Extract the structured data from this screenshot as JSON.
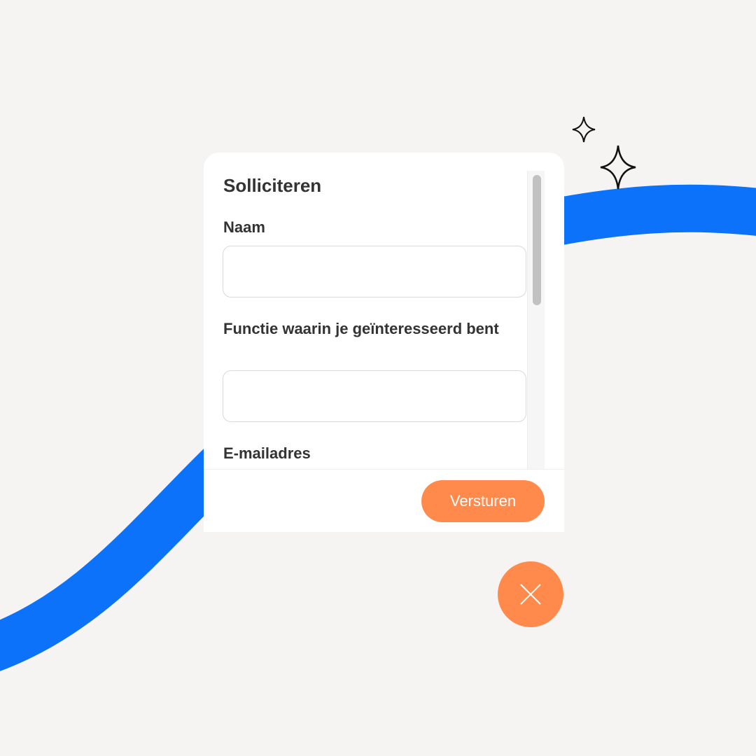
{
  "form": {
    "title": "Solliciteren",
    "fields": [
      {
        "label": "Naam",
        "value": "",
        "placeholder": ""
      },
      {
        "label": "Functie waarin je geïnteresseerd bent",
        "value": "",
        "placeholder": ""
      },
      {
        "label": "E-mailadres",
        "value": "",
        "placeholder": ""
      }
    ],
    "submit_label": "Versturen"
  },
  "close_button": {
    "icon": "close-icon",
    "label": "Sluiten"
  },
  "colors": {
    "accent": "#ff8a4c",
    "wave": "#0b72f9",
    "background": "#f5f4f2",
    "text": "#333333"
  }
}
